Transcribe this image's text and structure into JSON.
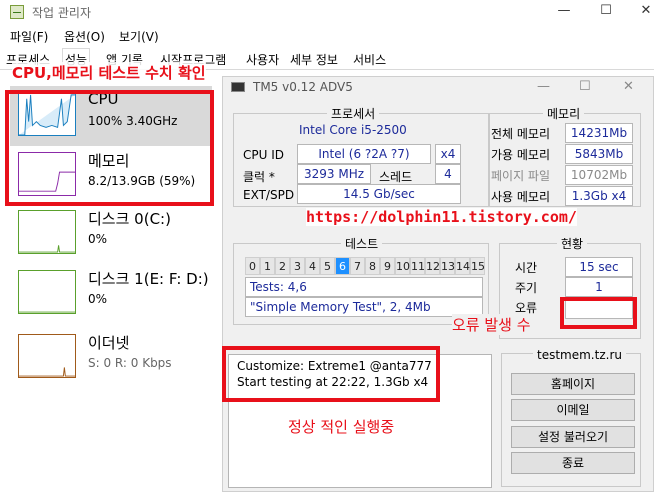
{
  "taskmgr": {
    "title": "작업 관리자",
    "menu": [
      "파일(F)",
      "옵션(O)",
      "보기(V)"
    ],
    "tabs": [
      "프로세스",
      "성능",
      "앱 기록",
      "시작프로그램",
      "사용자",
      "세부 정보",
      "서비스"
    ],
    "active_tab": "성능",
    "side": [
      {
        "name": "CPU",
        "detail": "100%  3.40GHz"
      },
      {
        "name": "메모리",
        "detail": "8.2/13.9GB (59%)"
      },
      {
        "name": "디스크 0(C:)",
        "detail": "0%"
      },
      {
        "name": "디스크 1(E: F: D:)",
        "detail": "0%"
      },
      {
        "name": "이더넷",
        "detail": "S: 0  R: 0 Kbps"
      }
    ]
  },
  "tm5": {
    "title": "TM5 v0.12 ADV5",
    "processor": {
      "title": "프로세서",
      "model": "Intel Core i5-2500",
      "cpu_id_label": "CPU ID",
      "cpu_id_value": "Intel  (6 ?2A ?7)",
      "cpu_id_mult": "x4",
      "clock_label": "클럭 *",
      "clock_value": "3293 MHz",
      "thread_label": "스레드",
      "thread_value": "4",
      "ext_label": "EXT/SPD",
      "ext_value": "14.5 Gb/sec"
    },
    "memory": {
      "title": "메모리",
      "rows": [
        {
          "label": "전체 메모리",
          "value": "14231Mb",
          "grey": false
        },
        {
          "label": "가용 메모리",
          "value": "5843Mb",
          "grey": false
        },
        {
          "label": "페이지 파일",
          "value": "10702Mb",
          "grey": true
        },
        {
          "label": "사용 메모리",
          "value": "1.3Gb x4",
          "grey": false
        }
      ]
    },
    "test": {
      "title": "테스트",
      "cells": [
        "0",
        "1",
        "2",
        "3",
        "4",
        "5",
        "6",
        "7",
        "8",
        "9",
        "10",
        "11",
        "12",
        "13",
        "14",
        "15"
      ],
      "active_cell": 6,
      "tests_line": "Tests: 4,6",
      "test_name": "\"Simple Memory Test\", 2, 4Mb"
    },
    "status": {
      "title": "현황",
      "time_label": "시간",
      "time_value": "15 sec",
      "cycle_label": "주기",
      "cycle_value": "1",
      "error_label": "오류",
      "error_value": ""
    },
    "log": [
      "Customize: Extreme1 @anta777",
      "Start testing at 22:22, 1.3Gb x4"
    ],
    "site": "testmem.tz.ru",
    "buttons": [
      "홈페이지",
      "이메일",
      "설정 불러오기",
      "종료"
    ]
  },
  "annotations": {
    "top_label": "CPU,메모리 테스트 수치 확인",
    "url": "https://dolphin11.tistory.com/",
    "error_label": "오류 발생 수",
    "running_label": "정상 적인 실행중"
  },
  "colors": {
    "accent_red": "#e8101a",
    "value_blue": "#1c2a9a",
    "cpu_graph": "#1a7fbf",
    "mem_graph": "#8b2aa8",
    "disk_graph": "#5aa02c",
    "net_graph": "#a05a1a"
  }
}
